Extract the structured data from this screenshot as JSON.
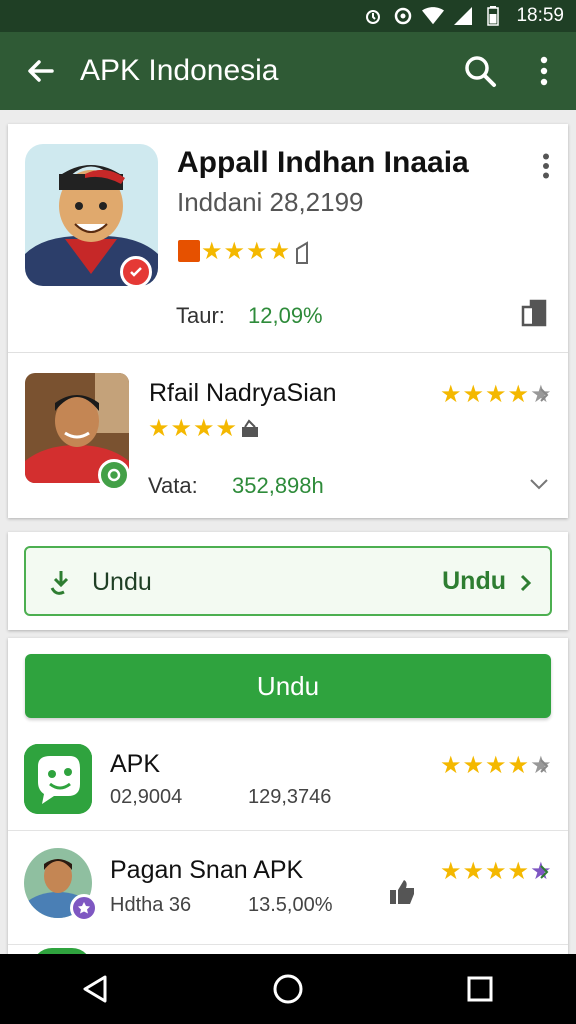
{
  "status_bar": {
    "time": "18:59",
    "icons": [
      "alarm-icon",
      "sync-icon",
      "wifi-icon",
      "signal-icon",
      "battery-icon"
    ]
  },
  "app_bar": {
    "title": "APK Indonesia",
    "back_icon": "arrow-back-icon",
    "search_icon": "search-icon",
    "menu_icon": "more-vert-icon"
  },
  "featured": {
    "title": "Appall Indhan Inaaia",
    "subtitle": "Inddani 28,2199",
    "rating_stars": 4,
    "stat_label": "Taur:",
    "stat_value": "12,09%"
  },
  "second": {
    "name": "Rfail NadryaSian",
    "rating_stars": 4,
    "stat_label": "Vata:",
    "stat_value": "352,898h"
  },
  "download_box": {
    "label": "Undu",
    "right_label": "Undu"
  },
  "big_button": {
    "label": "Undu"
  },
  "list": [
    {
      "name": "APK",
      "meta_left": "02,9004",
      "meta_right": "129,3746",
      "rating_stars": 4
    },
    {
      "name": "Pagan Snan APK",
      "meta_left": "Hdtha 36",
      "meta_right": "13.5,00%",
      "rating_stars": 4
    }
  ],
  "colors": {
    "appbar": "#2f5a35",
    "statusbar": "#1f3f25",
    "accent_green": "#2fa33e",
    "star": "#f4b800"
  }
}
